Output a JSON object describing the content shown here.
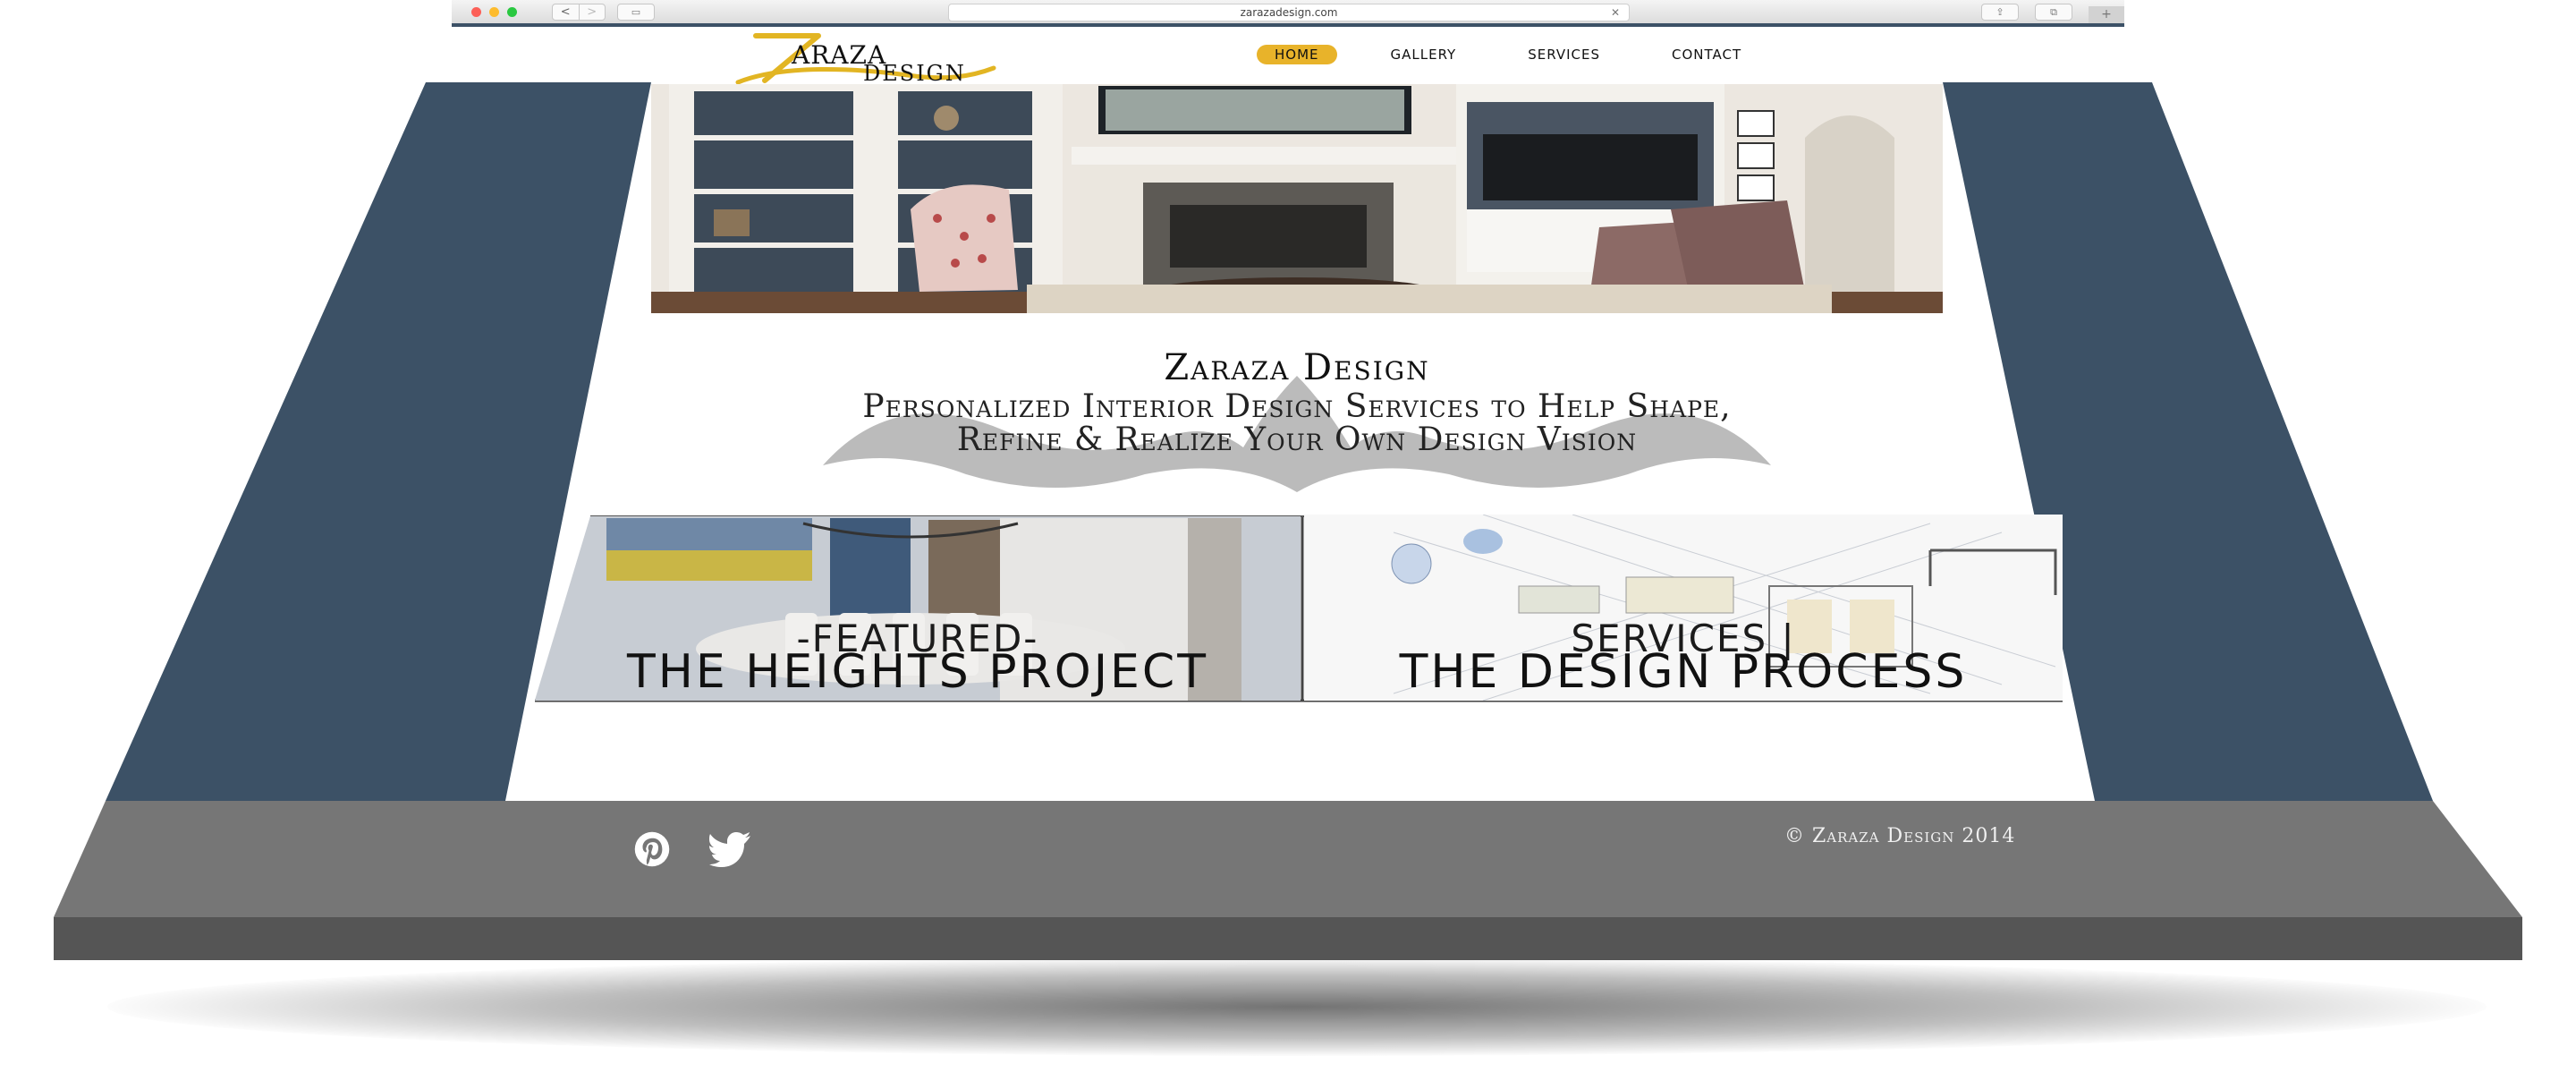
{
  "browser": {
    "url": "zarazadesign.com",
    "back_icon": "chevron-left-icon",
    "forward_icon": "chevron-right-icon",
    "sidebar_icon": "sidebar-icon",
    "share_icon": "share-icon",
    "tabs_icon": "tabs-icon",
    "new_tab_icon": "plus-icon",
    "back_glyph": "<",
    "forward_glyph": ">",
    "sidebar_glyph": "▭",
    "stop_glyph": "✕",
    "share_glyph": "⇪",
    "tabs_glyph": "⧉",
    "plus_glyph": "+"
  },
  "header": {
    "logo": {
      "initial": "Z",
      "line1": "ARAZA",
      "line2": "DESIGN"
    },
    "nav": [
      {
        "label": "HOME",
        "active": true
      },
      {
        "label": "GALLERY",
        "active": false
      },
      {
        "label": "SERVICES",
        "active": false
      },
      {
        "label": "CONTACT",
        "active": false
      }
    ]
  },
  "intro": {
    "title": "Zaraza Design",
    "subtitle": "Personalized Interior Design Services to Help Shape, Refine & Realize Your Own Design Vision"
  },
  "features": [
    {
      "kicker": "-FEATURED-",
      "headline": "THE HEIGHTS PROJECT"
    },
    {
      "kicker": "SERVICES |",
      "headline": "THE DESIGN PROCESS"
    }
  ],
  "footer": {
    "social": [
      {
        "name": "pinterest-icon"
      },
      {
        "name": "twitter-icon"
      }
    ],
    "copyright": "© Zaraza Design 2014"
  },
  "colors": {
    "page_side": "#3c5166",
    "footer_top": "#767676",
    "footer_front": "#555555",
    "nav_active": "#e8b32a",
    "logo_gold": "#e2b523"
  }
}
